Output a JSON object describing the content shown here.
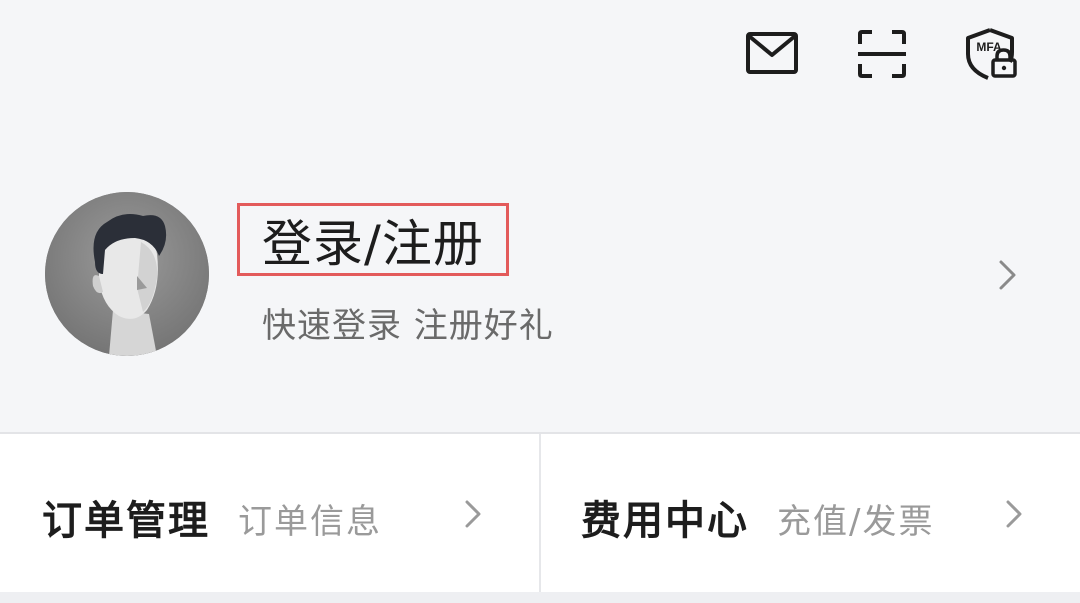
{
  "header": {
    "icons": [
      "mail-icon",
      "scan-icon",
      "mfa-icon"
    ],
    "mfa_text": "MFA"
  },
  "profile": {
    "title": "登录/注册",
    "subtitle": "快速登录 注册好礼",
    "highlight_color": "#e35b5b"
  },
  "cards": [
    {
      "title": "订单管理",
      "subtitle": "订单信息"
    },
    {
      "title": "费用中心",
      "subtitle": "充值/发票"
    }
  ],
  "colors": {
    "background": "#f5f6f8",
    "card_background": "#ffffff",
    "text_primary": "#1d1d1d",
    "text_secondary": "#9a9a9a"
  }
}
